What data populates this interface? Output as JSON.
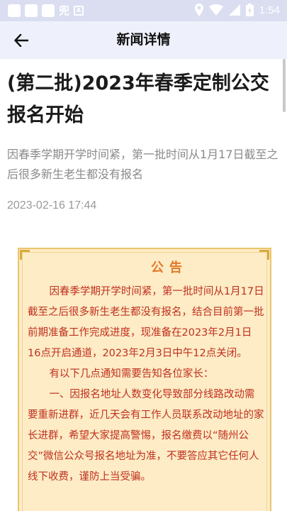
{
  "status_bar": {
    "glyph": "兜",
    "badge": "A",
    "time": "1:54"
  },
  "app_bar": {
    "title": "新闻详情",
    "back_icon": "arrow-left-icon"
  },
  "article": {
    "title": "(第二批)2023年春季定制公交报名开始",
    "summary": "因春季学期开学时间紧，第一批时间从1月17日截至之后很多新生老生都没有报名",
    "date": "2023-02-16 17:44"
  },
  "notice": {
    "heading": "公告",
    "paragraphs": [
      "因春季学期开学时间紧，第一批时间从1月17日截至之后很多新生老生都没有报名，结合目前第一批前期准备工作完成进度，现准备在2023年2月1日16点开启通道，2023年2月3日中午12点关闭。",
      "有以下几点通知需要告知各位家长：",
      "一、因报名地址人数变化导致部分线路改动需要重新进群，近几天会有工作人员联系改动地址的家长进群，希望大家提高警惕，报名缴费以“随州公交”微信公众号报名地址为准，不要答应其它任何人线下收费，谨防上当受骗。"
    ]
  },
  "colors": {
    "app_bar_bg": "#eef0fb",
    "notice_bg": "#fdecc6",
    "notice_text": "#c0301f",
    "notice_heading": "#e07a2a"
  }
}
